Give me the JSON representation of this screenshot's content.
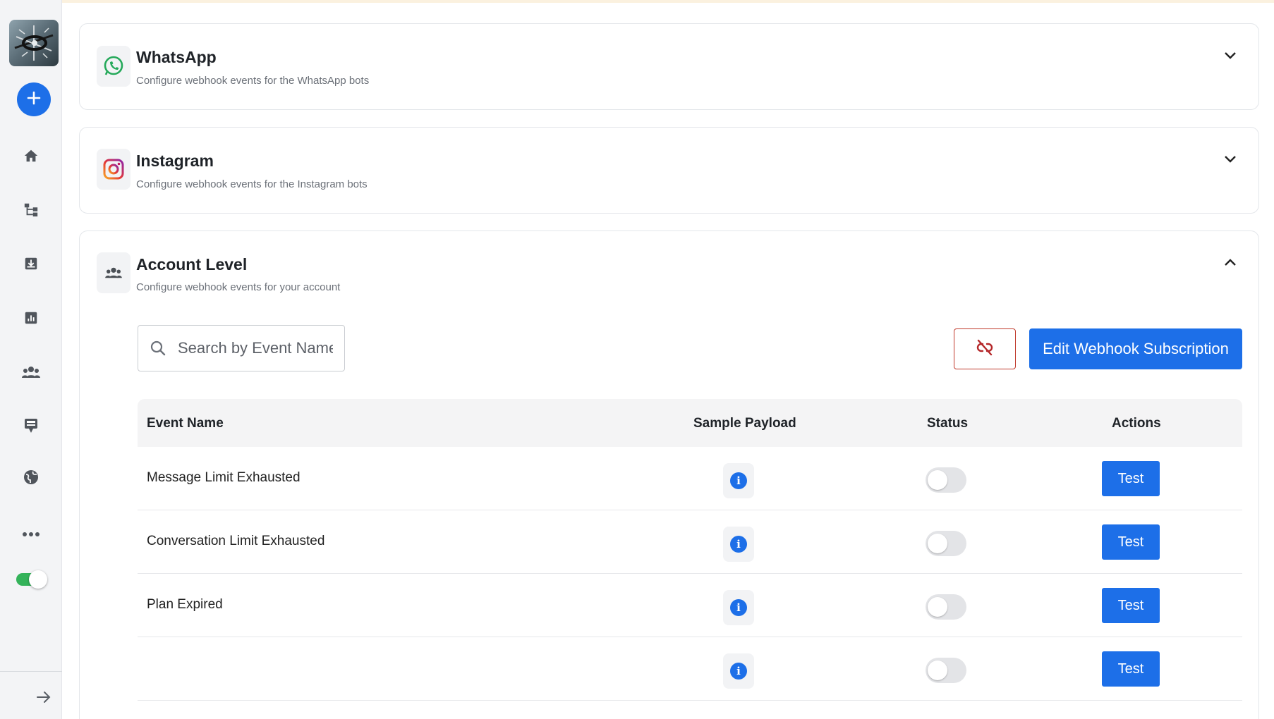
{
  "sidebar": {
    "nav_items": [
      "home-icon",
      "flow-icon",
      "inbox-icon",
      "analytics-icon",
      "team-icon",
      "broadcast-icon",
      "globe-icon",
      "more-icon"
    ],
    "toggle_on": true
  },
  "sections": [
    {
      "title": "WhatsApp",
      "subtitle": "Configure webhook events for the WhatsApp bots",
      "icon": "whatsapp-icon",
      "expanded": false
    },
    {
      "title": "Instagram",
      "subtitle": "Configure webhook events for the Instagram bots",
      "icon": "instagram-icon",
      "expanded": false
    },
    {
      "title": "Account Level",
      "subtitle": "Configure webhook events for your account",
      "icon": "people-icon",
      "expanded": true
    }
  ],
  "account": {
    "search": {
      "placeholder": "Search by Event Name",
      "value": ""
    },
    "edit_button": "Edit Webhook Subscription",
    "columns": {
      "event_name": "Event Name",
      "sample_payload": "Sample Payload",
      "status": "Status",
      "actions": "Actions"
    },
    "rows": [
      {
        "event": "Message Limit Exhausted",
        "status_on": false,
        "action": "Test"
      },
      {
        "event": "Conversation Limit Exhausted",
        "status_on": false,
        "action": "Test"
      },
      {
        "event": "Plan Expired",
        "status_on": false,
        "action": "Test"
      },
      {
        "event": "",
        "status_on": false,
        "action": "Test"
      }
    ]
  },
  "colors": {
    "primary": "#1d6fe8",
    "danger": "#c0392b",
    "whatsapp": "#25a95a",
    "toggle_on": "#34b35a"
  }
}
